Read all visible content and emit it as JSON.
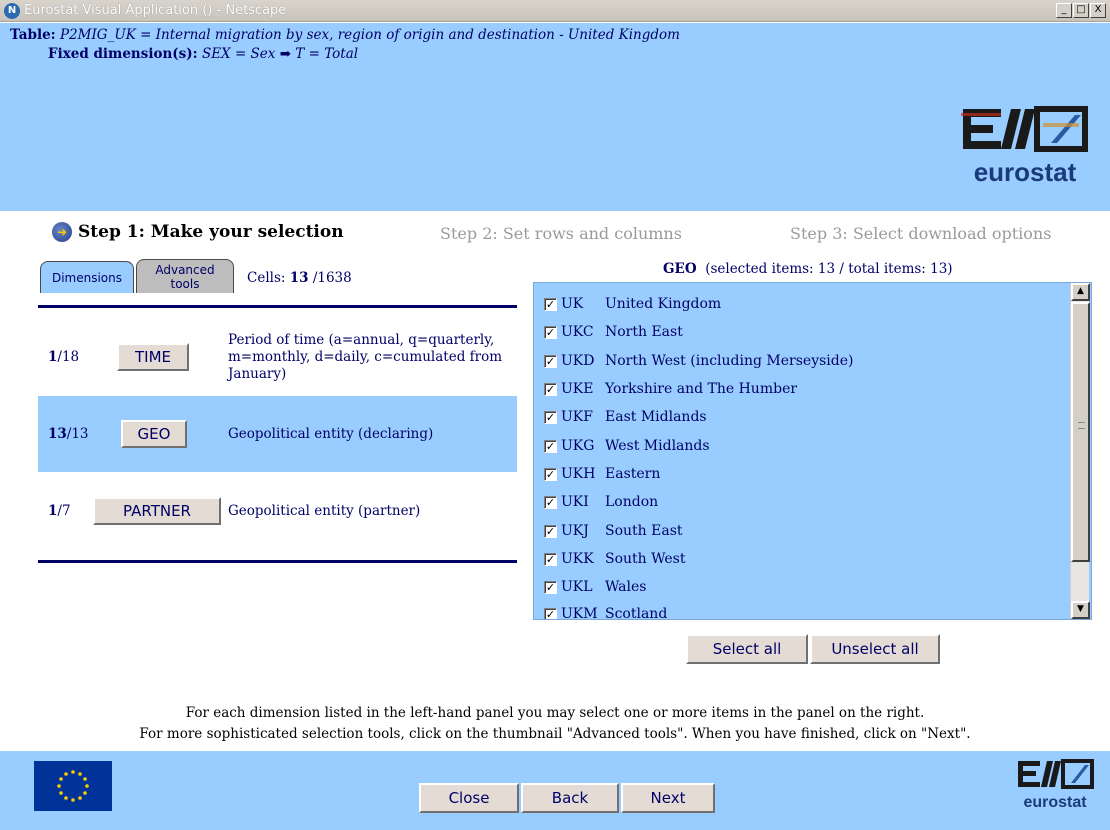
{
  "window": {
    "title": "Eurostat Visual Application () - Netscape",
    "app_icon": "N",
    "minimize": "_",
    "maximize": "□",
    "close": "X"
  },
  "header": {
    "table_label": "Table:",
    "table_text": "P2MIG_UK = Internal migration by sex, region of origin and destination - United Kingdom",
    "fixed_label": "Fixed dimension(s):",
    "fixed_text": "SEX = Sex ➡ T = Total",
    "logo_text": "eurostat"
  },
  "steps": {
    "step1": "Step 1: Make your selection",
    "step2": "Step 2: Set rows and columns",
    "step3": "Step 3: Select download options"
  },
  "tabs": {
    "dimensions": "Dimensions",
    "advanced": "Advanced tools"
  },
  "cells": {
    "label": "Cells:",
    "selected": "13",
    "total": "/1638"
  },
  "dimensions": [
    {
      "count": "1",
      "total": "/18",
      "button": "TIME",
      "description": "Period of time (a=annual, q=quarterly, m=monthly, d=daily, c=cumulated from January)"
    },
    {
      "count": "13",
      "total": "/13",
      "button": "GEO",
      "description": "Geopolitical entity (declaring)"
    },
    {
      "count": "1",
      "total": "/7",
      "button": "PARTNER",
      "description": "Geopolitical entity (partner)"
    }
  ],
  "geo": {
    "heading": "GEO",
    "summary": "(selected items: 13 / total items: 13)",
    "items": [
      {
        "code": "UK",
        "name": "United Kingdom",
        "checked": true
      },
      {
        "code": "UKC",
        "name": "North East",
        "checked": true
      },
      {
        "code": "UKD",
        "name": "North West (including Merseyside)",
        "checked": true
      },
      {
        "code": "UKE",
        "name": "Yorkshire and The Humber",
        "checked": true
      },
      {
        "code": "UKF",
        "name": "East Midlands",
        "checked": true
      },
      {
        "code": "UKG",
        "name": "West Midlands",
        "checked": true
      },
      {
        "code": "UKH",
        "name": "Eastern",
        "checked": true
      },
      {
        "code": "UKI",
        "name": "London",
        "checked": true
      },
      {
        "code": "UKJ",
        "name": "South East",
        "checked": true
      },
      {
        "code": "UKK",
        "name": "South West",
        "checked": true
      },
      {
        "code": "UKL",
        "name": "Wales",
        "checked": true
      },
      {
        "code": "UKM",
        "name": "Scotland",
        "checked": true
      }
    ],
    "select_all": "Select all",
    "unselect_all": "Unselect all"
  },
  "instructions": {
    "line1": "For each dimension listed in the left-hand panel you may select one or more items in the panel on the right.",
    "line2": "For more sophisticated selection tools, click on the thumbnail \"Advanced tools\". When you have finished, click on \"Next\"."
  },
  "footer": {
    "close": "Close",
    "back": "Back",
    "next": "Next",
    "logo_text": "eurostat"
  },
  "colors": {
    "panel_blue": "#99ccff",
    "text_navy": "#000066",
    "eu_blue": "#003399",
    "eu_star": "#ffcc00"
  }
}
